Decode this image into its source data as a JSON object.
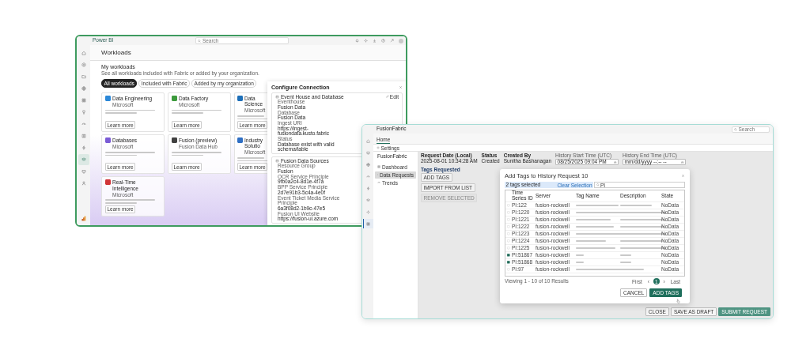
{
  "workloads_window": {
    "app_name": "Power BI",
    "search": {
      "placeholder": "Search"
    },
    "rail": [
      {
        "selected": false
      },
      {
        "selected": false
      },
      {
        "selected": false
      },
      {
        "selected": false
      },
      {
        "selected": false
      },
      {
        "selected": false
      },
      {
        "selected": false
      },
      {
        "selected": false
      },
      {
        "selected": false
      },
      {
        "selected": true
      },
      {
        "selected": false
      },
      {
        "selected": false
      }
    ],
    "page_title": "Workloads",
    "section_title": "My workloads",
    "section_subtitle": "See all workloads included with Fabric or added by your organization.",
    "filters": [
      {
        "label": "All workloads",
        "selected": true
      },
      {
        "label": "Included with Fabric",
        "selected": false
      },
      {
        "label": "Added by my organization",
        "selected": false
      }
    ],
    "cards": [
      {
        "title": "Data Engineering",
        "publisher": "Microsoft",
        "button": "Learn more",
        "color": "#2b88d8"
      },
      {
        "title": "Data Factory",
        "publisher": "Microsoft",
        "button": "Learn more",
        "color": "#3c9a3c"
      },
      {
        "title": "Data Science",
        "publisher": "Microsoft",
        "button": "Learn more",
        "color": "#1d6fb8"
      },
      {
        "title": "Databases",
        "publisher": "Microsoft",
        "button": "Learn more",
        "color": "#7b5cd6"
      },
      {
        "title": "Fusion (preview)",
        "publisher": "Fusion Data Hub",
        "button": "Learn more",
        "color": "#404040"
      },
      {
        "title": "Industry Solutio",
        "publisher": "Microsoft",
        "button": "Learn more",
        "color": "#2f6fc4"
      },
      {
        "title": "Real-Time Intelligence",
        "publisher": "Microsoft",
        "button": "Learn more",
        "color": "#d13438"
      }
    ],
    "connection_dialog": {
      "title": "Configure Connection",
      "sections": [
        {
          "title": "Event House and Database",
          "action": "Edit",
          "fields": [
            {
              "label": "Eventhouse",
              "value": "Fusion Data"
            },
            {
              "label": "Database",
              "value": "Fusion Data"
            },
            {
              "label": "Ingest URI",
              "value": "https://ingest-fusiondata.kusto.fabric"
            },
            {
              "label": "Status",
              "value": "Database exist with valid schema/table"
            }
          ]
        },
        {
          "title": "Fusion Data Sources",
          "fields": [
            {
              "label": "Resource Group",
              "value": "Fusion"
            },
            {
              "label": "OCR Service Principle",
              "value": "9fb0a2c4-8d1e-4f7a"
            },
            {
              "label": "BPP Service Principle",
              "value": "2d7e91b3-5c4a-4e0f"
            },
            {
              "label": "Event Ticket Media Service Principle",
              "value": "6a3f08d2-1b9c-47e5"
            },
            {
              "label": "Fusion UI Website",
              "value": "https://fusion-ui.azure.com"
            }
          ]
        }
      ]
    }
  },
  "fusion_window": {
    "app_name": "FusionFabric",
    "search": {
      "placeholder": "Search"
    },
    "rail": [
      {
        "selected": false
      },
      {
        "selected": false
      },
      {
        "selected": false
      },
      {
        "selected": false
      },
      {
        "selected": false
      },
      {
        "selected": false
      },
      {
        "selected": false
      },
      {
        "selected": true
      }
    ],
    "tab": "Home",
    "settings": "Settings",
    "nav": {
      "title": "FusionFabric",
      "items": [
        {
          "label": "Dashboard",
          "selected": false
        },
        {
          "label": "Data Requests",
          "selected": true
        },
        {
          "label": "Trends",
          "selected": false
        }
      ]
    },
    "request": {
      "fields": [
        {
          "label": "Request Date (Local)",
          "value": "2025-08-01 10:34:28 AM"
        },
        {
          "label": "Status",
          "value": "Created"
        },
        {
          "label": "Created By",
          "value": "Sunitha Bashanagan"
        }
      ],
      "inputs": [
        {
          "label": "History Start Time (UTC)",
          "value": "08/25/2025 09:04 PM"
        },
        {
          "label": "History End Time (UTC)",
          "value": "mm/dd/yyyy --:-- --"
        }
      ],
      "section_title": "Tags Requested",
      "actions": [
        {
          "label": "ADD TAGS",
          "disabled": false
        },
        {
          "label": "IMPORT FROM LIST",
          "disabled": false
        },
        {
          "label": "REMOVE SELECTED",
          "disabled": true
        }
      ]
    },
    "dialog": {
      "title": "Add Tags to History Request 10",
      "selection": "2 tags selected",
      "clear": "Clear Selection",
      "search_value": "PI",
      "columns": [
        "Time Series ID",
        "Server",
        "Tag Name",
        "Description",
        "State"
      ],
      "rows": [
        {
          "checked": false,
          "id": "PI:122",
          "server": "fusion-rockwell",
          "state": "NoData"
        },
        {
          "checked": false,
          "id": "PI:1220",
          "server": "fusion-rockwell",
          "state": "NoData"
        },
        {
          "checked": false,
          "id": "PI:1221",
          "server": "fusion-rockwell",
          "state": "NoData"
        },
        {
          "checked": false,
          "id": "PI:1222",
          "server": "fusion-rockwell",
          "state": "NoData"
        },
        {
          "checked": false,
          "id": "PI:1223",
          "server": "fusion-rockwell",
          "state": "NoData"
        },
        {
          "checked": false,
          "id": "PI:1224",
          "server": "fusion-rockwell",
          "state": "NoData"
        },
        {
          "checked": false,
          "id": "PI:1225",
          "server": "fusion-rockwell",
          "state": "NoData"
        },
        {
          "checked": true,
          "id": "PI:51867",
          "server": "fusion-rockwell",
          "state": "NoData"
        },
        {
          "checked": true,
          "id": "PI:51868",
          "server": "fusion-rockwell",
          "state": "NoData"
        },
        {
          "checked": false,
          "id": "PI:97",
          "server": "fusion-rockwell",
          "state": "NoData"
        }
      ],
      "results": "Viewing 1 - 10 of 10 Results",
      "pager": [
        {
          "label": "First",
          "selected": false
        },
        {
          "label": "‹",
          "selected": false
        },
        {
          "label": "1",
          "selected": true
        },
        {
          "label": "›",
          "selected": false
        },
        {
          "label": "Last",
          "selected": false
        }
      ],
      "buttons": [
        {
          "label": "CANCEL",
          "kind": "secondary"
        },
        {
          "label": "ADD TAGS",
          "kind": "primary"
        }
      ]
    },
    "footer_buttons": [
      {
        "label": "CLOSE",
        "kind": "secondary"
      },
      {
        "label": "SAVE AS DRAFT",
        "kind": "secondary"
      },
      {
        "label": "SUBMIT REQUEST",
        "kind": "primary"
      }
    ]
  }
}
